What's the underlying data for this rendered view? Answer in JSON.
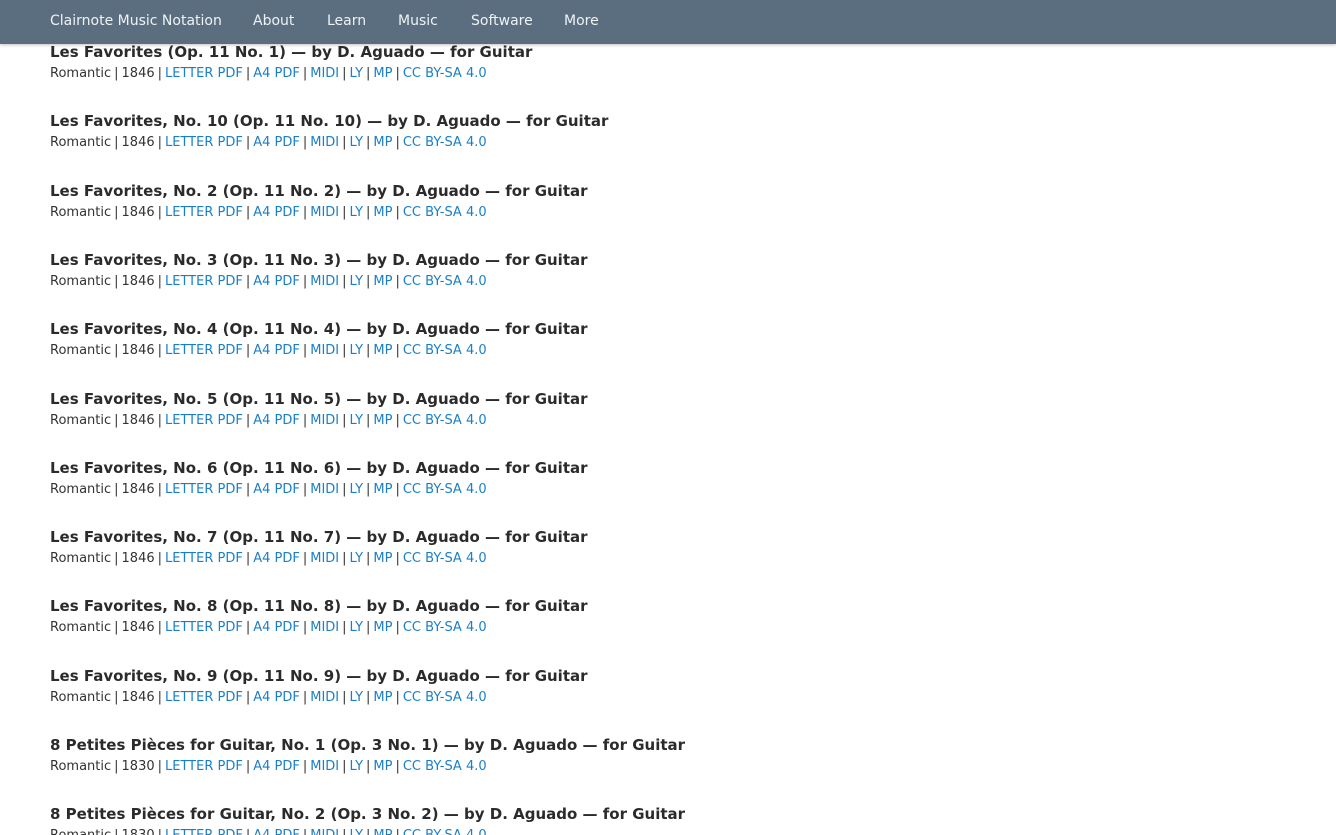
{
  "nav": {
    "brand": "Clairnote Music Notation",
    "items": [
      "About",
      "Learn",
      "Music",
      "Software",
      "More"
    ]
  },
  "colors": {
    "navbar": "#5b6e80",
    "link": "#1a7fc8",
    "title": "#2b2b2b"
  },
  "link_labels": [
    "LETTER PDF",
    "A4 PDF",
    "MIDI",
    "LY",
    "MP",
    "CC BY-SA 4.0"
  ],
  "entries": [
    {
      "title": "Les Favorites (Op. 11 No. 1) — by D. Aguado — for Guitar",
      "style": "Romantic",
      "year": "1846"
    },
    {
      "title": "Les Favorites, No. 10 (Op. 11 No. 10) — by D. Aguado — for Guitar",
      "style": "Romantic",
      "year": "1846"
    },
    {
      "title": "Les Favorites, No. 2 (Op. 11 No. 2) — by D. Aguado — for Guitar",
      "style": "Romantic",
      "year": "1846"
    },
    {
      "title": "Les Favorites, No. 3 (Op. 11 No. 3) — by D. Aguado — for Guitar",
      "style": "Romantic",
      "year": "1846"
    },
    {
      "title": "Les Favorites, No. 4 (Op. 11 No. 4) — by D. Aguado — for Guitar",
      "style": "Romantic",
      "year": "1846"
    },
    {
      "title": "Les Favorites, No. 5 (Op. 11 No. 5) — by D. Aguado — for Guitar",
      "style": "Romantic",
      "year": "1846"
    },
    {
      "title": "Les Favorites, No. 6 (Op. 11 No. 6) — by D. Aguado — for Guitar",
      "style": "Romantic",
      "year": "1846"
    },
    {
      "title": "Les Favorites, No. 7 (Op. 11 No. 7) — by D. Aguado — for Guitar",
      "style": "Romantic",
      "year": "1846"
    },
    {
      "title": "Les Favorites, No. 8 (Op. 11 No. 8) — by D. Aguado — for Guitar",
      "style": "Romantic",
      "year": "1846"
    },
    {
      "title": "Les Favorites, No. 9 (Op. 11 No. 9) — by D. Aguado — for Guitar",
      "style": "Romantic",
      "year": "1846"
    },
    {
      "title": "8 Petites Pièces for Guitar, No. 1 (Op. 3 No. 1) — by D. Aguado — for Guitar",
      "style": "Romantic",
      "year": "1830"
    },
    {
      "title": "8 Petites Pièces for Guitar, No. 2 (Op. 3 No. 2) — by D. Aguado — for Guitar",
      "style": "Romantic",
      "year": "1830"
    }
  ]
}
